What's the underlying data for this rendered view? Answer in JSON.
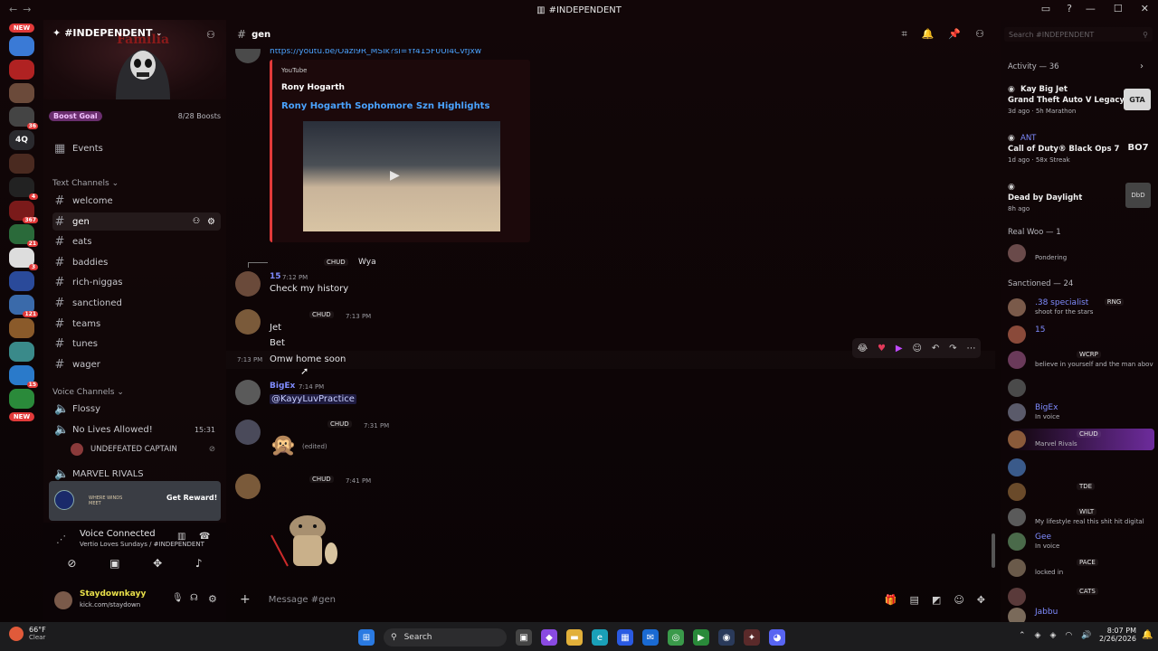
{
  "window": {
    "title": "#INDEPENDENT"
  },
  "rail": {
    "new_top": "NEW",
    "new_bottom": "NEW",
    "badges": [
      "36",
      "4",
      "367",
      "21",
      "3",
      "121",
      "15"
    ],
    "text_server": "4Q"
  },
  "server": {
    "name": "#INDEPENDENT",
    "boost_goal": "Boost Goal",
    "boost_count": "8/28 Boosts",
    "events": "Events",
    "text_category": "Text Channels",
    "voice_category": "Voice Channels",
    "text_channels": [
      "welcome",
      "gen",
      "eats",
      "baddies",
      "rich-niggas",
      "sanctioned",
      "teams",
      "tunes",
      "wager"
    ],
    "voice_channels": [
      "Flossy",
      "No Lives Allowed!"
    ],
    "voice_timer": "15:31",
    "voice_user": "UNDEFEATED CAPTAIN",
    "marvel": "MARVEL RIVALS"
  },
  "promo": {
    "logo_text": "WHERE WINDS MEET",
    "button": "Get Reward!"
  },
  "voice": {
    "status": "Voice Connected",
    "channel": "Vertio Loves Sundays / #INDEPENDENT",
    "user": "Staydownkayy",
    "user_status": "kick.com/staydown"
  },
  "chat": {
    "channel": "gen",
    "search_placeholder": "Search #INDEPENDENT",
    "link": "https://youtu.be/OazI9R_MSik?si=Yf415F0UI4CvfJxw",
    "embed": {
      "provider": "YouTube",
      "author": "Rony Hogarth",
      "title": "Rony Hogarth Sophomore Szn Highlights"
    },
    "reply_tag": "CHUD",
    "reply_text": "Wya",
    "messages": [
      {
        "user": "15",
        "time": "7:12 PM",
        "lines": [
          "Check my history"
        ]
      },
      {
        "user": "",
        "tag": "CHUD",
        "time": "7:13 PM",
        "lines": [
          "Jet",
          "Bet"
        ]
      },
      {
        "hover_time": "7:13 PM",
        "lines": [
          "Omw home soon"
        ]
      },
      {
        "user": "BigEx",
        "time": "7:14 PM",
        "lines": [
          "@KayyLuvPractice"
        ]
      },
      {
        "user": "",
        "tag": "CHUD",
        "time": "7:31 PM",
        "edited": "(edited)"
      },
      {
        "user": "",
        "tag": "CHUD",
        "time": "7:41 PM"
      }
    ],
    "composer_placeholder": "Message #gen"
  },
  "members": {
    "activity_header": "Activity — 36",
    "activities": [
      {
        "name": "Kay Big Jet",
        "game": "Grand Theft Auto V Legacy",
        "meta": "3d ago · 5h Marathon",
        "logo": "GTA"
      },
      {
        "name": "ANT",
        "game": "Call of Duty® Black Ops 7",
        "meta": "1d ago · 58x Streak",
        "logo": "BO7"
      },
      {
        "name": "",
        "game": "Dead by Daylight",
        "meta": "8h ago",
        "logo": "DbD"
      }
    ],
    "group1_header": "Real Woo — 1",
    "group1": [
      {
        "name": "",
        "sub": "Pondering"
      }
    ],
    "group2_header": "Sanctioned — 24",
    "group2": [
      {
        "name": ".38 specialist",
        "tag": "RNG",
        "sub": "shoot for the stars",
        "color": "#7f8cff"
      },
      {
        "name": "15",
        "tag": "",
        "sub": "",
        "color": "#7f8cff"
      },
      {
        "name": "",
        "tag": "WCRP",
        "sub": "believe in yourself and the man abov",
        "color": "#7f8cff"
      },
      {
        "name": "",
        "tag": "",
        "sub": "",
        "color": "#7f8cff"
      },
      {
        "name": "BigEx",
        "tag": "",
        "sub": "In voice",
        "color": "#7f8cff"
      },
      {
        "name": "",
        "tag": "CHUD",
        "sub": "Marvel Rivals",
        "color": "#7f8cff"
      },
      {
        "name": "",
        "tag": "",
        "sub": "",
        "color": "#7f8cff"
      },
      {
        "name": "",
        "tag": "TDE",
        "sub": "",
        "color": "#7f8cff"
      },
      {
        "name": "",
        "tag": "WILT",
        "sub": "My lifestyle real this shit hit digital",
        "color": "#7f8cff"
      },
      {
        "name": "Gee",
        "tag": "",
        "sub": "In voice",
        "color": "#7f8cff"
      },
      {
        "name": "",
        "tag": "PACE",
        "sub": "locked in",
        "color": "#7f8cff"
      },
      {
        "name": "",
        "tag": "CATS",
        "sub": "",
        "color": "#7f8cff"
      },
      {
        "name": "Jabbu",
        "tag": "",
        "sub": "",
        "color": "#7f8cff"
      }
    ]
  },
  "taskbar": {
    "weather_temp": "66°F",
    "weather_desc": "Clear",
    "search": "Search",
    "time": "8:07 PM",
    "date": "2/26/2026"
  },
  "colors": {
    "accent": "#e23a3a",
    "link": "#4aa3ff",
    "name_blue": "#7f8cff"
  }
}
